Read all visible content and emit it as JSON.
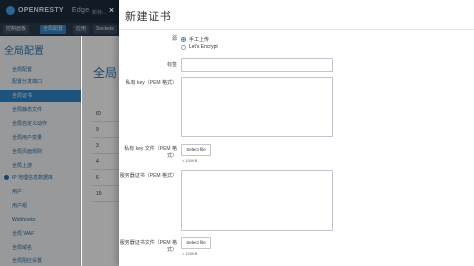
{
  "app": {
    "brand": "OPENRESTY",
    "product": "Edge",
    "topbar_extra": "新特..."
  },
  "tabs": [
    {
      "label": "控制面板"
    },
    {
      "label": "全局配置"
    },
    {
      "label": "应用"
    },
    {
      "label": "Sockets"
    }
  ],
  "sidebar": {
    "title": "全局配置",
    "items": [
      {
        "label": "全局配置"
      },
      {
        "label": "配置分发端口"
      },
      {
        "label": "全局证书"
      },
      {
        "label": "全局静态文件"
      },
      {
        "label": "全局自定义动作"
      },
      {
        "label": "全局用户变量"
      },
      {
        "label": "全局页面规则"
      },
      {
        "label": "全局上游"
      },
      {
        "label": "IP 地理信息数据库"
      },
      {
        "label": "用户"
      },
      {
        "label": "用户组"
      },
      {
        "label": "Webhooks"
      },
      {
        "label": "全局 WAF"
      },
      {
        "label": "全局域名"
      },
      {
        "label": "全局阻应设置"
      }
    ]
  },
  "main": {
    "title": "全局",
    "table_rows": [
      "ID",
      "9",
      "3",
      "4",
      "6",
      "19"
    ]
  },
  "modal": {
    "close_icon": "×",
    "title": "新建证书",
    "source": {
      "label": "源",
      "options": [
        {
          "label": "手工上传",
          "checked": true
        },
        {
          "label": "Let's Encrypt",
          "checked": false
        }
      ]
    },
    "fields": {
      "tag_label": "标签",
      "private_key_pem_label": "私有 key（PEM 格式）",
      "private_key_file_label": "私有 key 文件（PEM 格式）",
      "server_cert_pem_label": "服务器证书（PEM 格式）",
      "server_cert_file_label": "服务器证书文件（PEM 格式）"
    },
    "file_button_label": "Select file",
    "file_size_hint": "< 100KB"
  }
}
